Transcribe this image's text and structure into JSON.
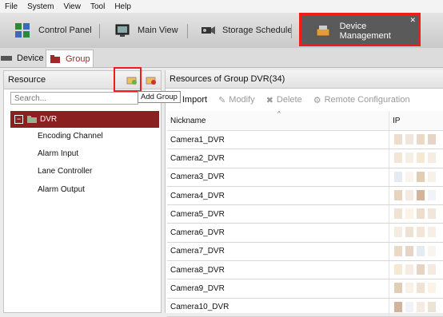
{
  "menu": [
    "File",
    "System",
    "View",
    "Tool",
    "Help"
  ],
  "toolbar": {
    "control_panel": "Control Panel",
    "main_view": "Main View",
    "storage_schedule": "Storage Schedule",
    "device_management": "Device Management"
  },
  "tabs": {
    "device": "Device",
    "group": "Group"
  },
  "resource": {
    "title": "Resource",
    "search_placeholder": "Search...",
    "tooltip": "Add Group",
    "tree_root": "DVR",
    "children": [
      "Encoding Channel",
      "Alarm Input",
      "Lane Controller",
      "Alarm Output"
    ]
  },
  "group": {
    "title": "Resources of Group DVR(34)",
    "actions": {
      "import": "Import",
      "modify": "Modify",
      "delete": "Delete",
      "remote_config": "Remote Configuration"
    },
    "columns": {
      "nickname": "Nickname",
      "ip": "IP"
    },
    "rows": [
      "Camera1_DVR",
      "Camera2_DVR",
      "Camera3_DVR",
      "Camera4_DVR",
      "Camera5_DVR",
      "Camera6_DVR",
      "Camera7_DVR",
      "Camera8_DVR",
      "Camera9_DVR",
      "Camera10_DVR"
    ]
  },
  "colors": {
    "accent_red": "#8b2020",
    "highlight": "#f01c1c"
  }
}
